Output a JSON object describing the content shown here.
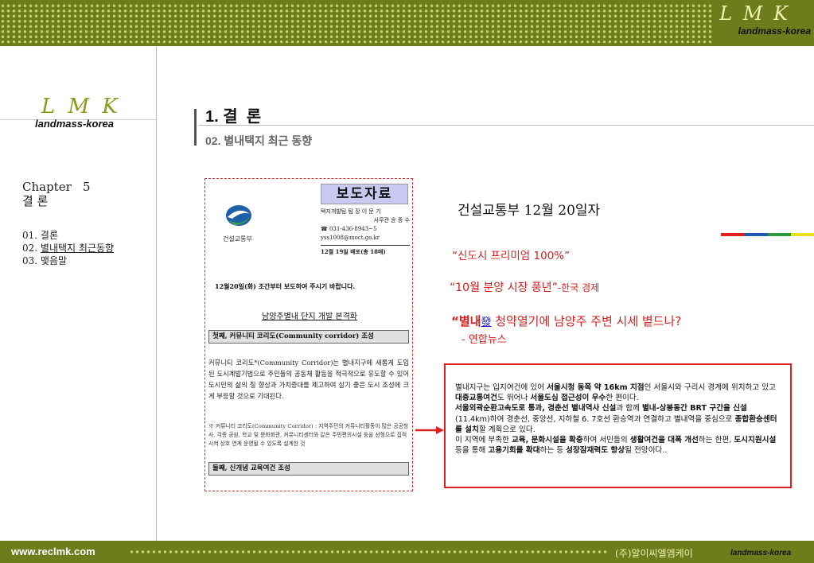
{
  "header": {
    "logo_text": "L M K",
    "logo_sub": "landmass-korea"
  },
  "sidebar": {
    "logo_text": "L M K",
    "logo_sub": "landmass-korea",
    "chapter": "Chapter   5",
    "chapter_title": "결 론",
    "toc": [
      {
        "label": "01. 결론",
        "active": false
      },
      {
        "label_prefix": "02. ",
        "label": "별내택지 최근동향",
        "active": true
      },
      {
        "label": "03. 맺음말",
        "active": false
      }
    ]
  },
  "main": {
    "title_num": "1.",
    "title": " 결  론",
    "subtitle_num": "02.",
    "subtitle": " 별내택지 최근 동향"
  },
  "press_release": {
    "title": "보도자료",
    "org": "건설교통부",
    "contact": {
      "team": "택지개발팀  팀  장 이 문 기",
      "officer": "사무관 윤 종 수",
      "phone": "☎ 031-436-8943~5",
      "email": "yss1008@moct.go.kr",
      "distribution": "12월 19일  배포(총  18매)"
    },
    "embargo": "12월20일(화) 조간부터 보도하여 주시기 바랍니다.",
    "headline": "남양주별내 단지 개발 본격화",
    "section1": "첫째, 커뮤니티 코리도(Community corridor) 조성",
    "body": "커뮤니티 코리도*(Community Corridor)는 별내지구에 새롭게 도입된 도시계발기법으로 주민들의 공동체 활동을 적극적으로 유도할 수 있어 도시민의 삶의 질 향상과 가치증대를 제고하여 살기 좋은 도시 조성에 크게 부응할 것으로 기대된다.",
    "note": "※ 커뮤니티 코리도(Community Corridor) : 지역주민의 커뮤니티활동이 많은 공공청사, 각종 공원, 학교 및 문화회관, 커뮤니티센터와 같은 주민편의시설 등을 선형으로 집적시켜 상호 연계 운영될 수 있도록 설계한 것",
    "section2": "둘째, 신개념 교육여건 조성"
  },
  "news": {
    "date": "건설교통부 12월 20일자",
    "quote1": "“신도시 프리미엄 100%”",
    "quote2": "“10월 분양 시장 풍년”",
    "quote2_src": "-한국 경제",
    "quote3_pre": "“별내",
    "quote3_hanja": "發",
    "quote3_post": " 청약열기에 남양주 주변 시세 볕드나?",
    "quote3_src": "- 연합뉴스"
  },
  "summary_box": {
    "lines": [
      "별내지구는 입지여건에 있어 서울시청 동쪽 약 16km 지점인 서울시와 구리시 경계에 위치하고 있고 대중교통여건도 뛰어나 서울도심 접근성이 우수한 편이다.",
      "서울외곽순환고속도로 통과, 경춘선 별내역사 신설과 함께 별내-상봉동간 BRT 구간을 신설(11.4km)하여 경춘선, 중앙선, 지하철 6. 7호선 환승역과 연결하고 별내역을 중심으로 종합환승센터를 설치할 계획으로 있다.",
      "이 지역에 부족한 교육, 문화시설을 확충하여 서민들의 생활여건을 대폭 개선하는 한편, 도시지원시설 등을 통해 고용기회를 확대하는 등 성장잠재력도 향상될 전망이다.."
    ]
  },
  "footer": {
    "url": "www.reclmk.com",
    "company": "(주)알이씨엘엠케이",
    "sub": "landmass-korea"
  },
  "colors": {
    "band": "#6e7d1c",
    "accent_red": "#d62020",
    "accent_bar": [
      "#e02020",
      "#1e5ab4",
      "#2a9a3a",
      "#e8e020"
    ]
  }
}
